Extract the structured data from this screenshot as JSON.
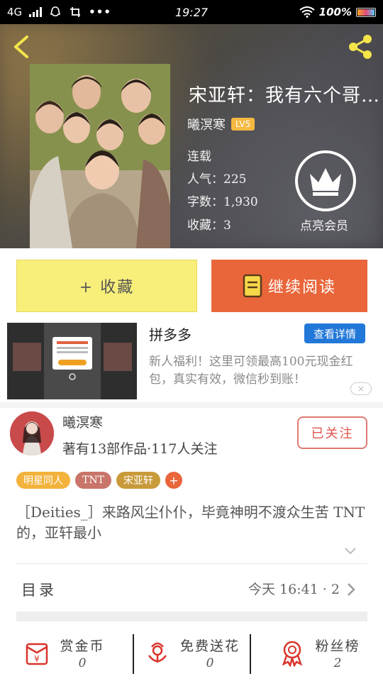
{
  "status_bar": {
    "network": "4G",
    "time": "19:27",
    "battery": "100%",
    "battery_level": 1.0
  },
  "header": {
    "book_title": "宋亚轩：我有六个哥…",
    "author": "曦溟寒",
    "author_level": "LV5",
    "status": "连载",
    "popularity": "人气：225",
    "word_count": "字数：1,930",
    "favorites": "收藏：3",
    "vip_label": "点亮会员"
  },
  "actions": {
    "collect_label": "+ 收藏",
    "read_label": "继续阅读"
  },
  "ad": {
    "title": "拼多多",
    "detail_label": "查看详情",
    "description": "新人福利！这里可领最高100元现金红包，真实有效，微信秒到账！",
    "close_label": "×"
  },
  "author_card": {
    "name": "曦溟寒",
    "stats": "著有13部作品·117人关注",
    "follow_label": "已关注"
  },
  "tags": [
    {
      "label": "明星同人",
      "color": "#f2b23b"
    },
    {
      "label": "TNT",
      "color": "#c9756a"
    },
    {
      "label": "宋亚轩",
      "color": "#c99a3a"
    }
  ],
  "tag_add": "+",
  "description": "［Deities_］来路风尘仆仆，毕竟神明不渡众生苦 TNT的，亚轩最小",
  "toc": {
    "label": "目录",
    "update": "今天 16:41 · 2."
  },
  "bottom_bar": [
    {
      "label": "赏金币",
      "count": "0",
      "icon": "coin-envelope-icon"
    },
    {
      "label": "免费送花",
      "count": "0",
      "icon": "flower-icon"
    },
    {
      "label": "粉丝榜",
      "count": "2",
      "icon": "medal-icon"
    }
  ],
  "colors": {
    "accent_orange": "#e9663a",
    "collect_yellow": "#f8ef7a",
    "follow_red": "#e0564f",
    "detail_blue": "#2278d8"
  }
}
